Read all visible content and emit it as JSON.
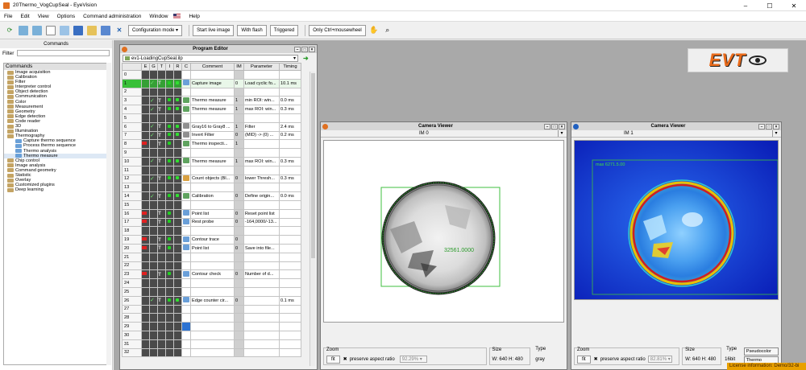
{
  "window": {
    "title": "20Thermo_VogCupSeal - EyeVision"
  },
  "menu": [
    "File",
    "Edit",
    "View",
    "Options",
    "Command administration",
    "Window",
    "Help"
  ],
  "toolbar": {
    "config_mode": "Configuration mode",
    "start_live": "Start live image",
    "with_flash": "With flash",
    "triggered": "Triggered",
    "only_ctrl": "Only Ctrl+mousewheel"
  },
  "commands_panel": {
    "header": "Commands",
    "filter_label": "Filter",
    "filter_value": "",
    "root": "Commands",
    "items": [
      {
        "label": "Image acquisition",
        "sub": false
      },
      {
        "label": "Calibration",
        "sub": false
      },
      {
        "label": "Filter",
        "sub": false
      },
      {
        "label": "Interpreter control",
        "sub": false
      },
      {
        "label": "Object detection",
        "sub": false
      },
      {
        "label": "Communication",
        "sub": false
      },
      {
        "label": "Color",
        "sub": false
      },
      {
        "label": "Measurement",
        "sub": false
      },
      {
        "label": "Geometry",
        "sub": false
      },
      {
        "label": "Edge detection",
        "sub": false
      },
      {
        "label": "Code reader",
        "sub": false
      },
      {
        "label": "3D",
        "sub": false
      },
      {
        "label": "Illumination",
        "sub": false
      },
      {
        "label": "Thermography",
        "sub": false
      },
      {
        "label": "Capture thermo sequence",
        "sub": true
      },
      {
        "label": "Process thermo sequence",
        "sub": true
      },
      {
        "label": "Thermo analysis",
        "sub": true
      },
      {
        "label": "Thermo measure",
        "sub": true
      },
      {
        "label": "Chip control",
        "sub": false
      },
      {
        "label": "Image analysis",
        "sub": false
      },
      {
        "label": "Command geometry",
        "sub": false
      },
      {
        "label": "Statistic",
        "sub": false
      },
      {
        "label": "Overlay",
        "sub": false
      },
      {
        "label": "Customized plugins",
        "sub": false
      },
      {
        "label": "Deep learning",
        "sub": false
      }
    ]
  },
  "program_editor": {
    "title": "Program Editor",
    "file": "ev1-LoadingCupSeal.ilp",
    "columns": [
      "E",
      "G",
      "T",
      "I",
      "R",
      "C",
      "Comment",
      "IM",
      "Parameter",
      "Timing"
    ],
    "rows": [
      {
        "n": "0",
        "cmd": "",
        "im": "",
        "param": "",
        "timing": "",
        "chk": false,
        "t": false,
        "x": false,
        "icon": "",
        "dots": 0
      },
      {
        "n": "1",
        "cmd": "Capture image",
        "im": "0",
        "param": "Load cyclic fo...",
        "timing": "10.1 ms",
        "chk": true,
        "t": true,
        "x": false,
        "icon": "#6a9fd8",
        "dots": 2,
        "active": true
      },
      {
        "n": "2",
        "cmd": "",
        "im": "",
        "param": "",
        "timing": "",
        "chk": false,
        "t": false,
        "x": false,
        "icon": "",
        "dots": 0
      },
      {
        "n": "3",
        "cmd": "Thermo measure",
        "im": "1",
        "param": "min ROI: win...",
        "timing": "0.0 ms",
        "chk": true,
        "t": true,
        "x": false,
        "icon": "#5fa35f",
        "dots": 2
      },
      {
        "n": "4",
        "cmd": "Thermo measure",
        "im": "1",
        "param": "max ROI: win...",
        "timing": "0.3 ms",
        "chk": true,
        "t": true,
        "x": false,
        "icon": "#5fa35f",
        "dots": 2
      },
      {
        "n": "5",
        "cmd": "",
        "im": "",
        "param": "",
        "timing": "",
        "chk": false,
        "t": false,
        "x": false,
        "icon": "",
        "dots": 0
      },
      {
        "n": "6",
        "cmd": "Gray16 to Gray8 ...",
        "im": "1",
        "param": "Filter",
        "timing": "2.4 ms",
        "chk": true,
        "t": true,
        "x": false,
        "icon": "#8f8f8f",
        "dots": 2
      },
      {
        "n": "7",
        "cmd": "Invert Filter",
        "im": "0",
        "param": "(MID) -> (0) ...",
        "timing": "0.2 ms",
        "chk": true,
        "t": true,
        "x": false,
        "icon": "#8f8f8f",
        "dots": 2
      },
      {
        "n": "8",
        "cmd": "Thermo inspecti...",
        "im": "1",
        "param": "",
        "timing": "",
        "chk": false,
        "t": true,
        "x": true,
        "icon": "#5fa35f",
        "dots": 1
      },
      {
        "n": "9",
        "cmd": "",
        "im": "",
        "param": "",
        "timing": "",
        "chk": false,
        "t": false,
        "x": false,
        "icon": "",
        "dots": 0
      },
      {
        "n": "10",
        "cmd": "Thermo measure",
        "im": "1",
        "param": "max ROI: win...",
        "timing": "0.3 ms",
        "chk": true,
        "t": true,
        "x": false,
        "icon": "#5fa35f",
        "dots": 2
      },
      {
        "n": "11",
        "cmd": "",
        "im": "",
        "param": "",
        "timing": "",
        "chk": false,
        "t": false,
        "x": false,
        "icon": "",
        "dots": 0
      },
      {
        "n": "12",
        "cmd": "Count objects (Bl...",
        "im": "0",
        "param": "lower Thresh...",
        "timing": "0.3 ms",
        "chk": true,
        "t": true,
        "x": false,
        "icon": "#d8a040",
        "dots": 2
      },
      {
        "n": "13",
        "cmd": "",
        "im": "",
        "param": "",
        "timing": "",
        "chk": false,
        "t": false,
        "x": false,
        "icon": "",
        "dots": 0
      },
      {
        "n": "14",
        "cmd": "Calibration",
        "im": "0",
        "param": "Define origin...",
        "timing": "0.0 ms",
        "chk": true,
        "t": true,
        "x": false,
        "icon": "#5fa35f",
        "dots": 2
      },
      {
        "n": "15",
        "cmd": "",
        "im": "",
        "param": "",
        "timing": "",
        "chk": false,
        "t": false,
        "x": false,
        "icon": "",
        "dots": 0
      },
      {
        "n": "16",
        "cmd": "Point list",
        "im": "0",
        "param": "Reset point list",
        "timing": "",
        "chk": false,
        "t": true,
        "x": true,
        "icon": "#6a9fd8",
        "dots": 1
      },
      {
        "n": "17",
        "cmd": "Rest probe",
        "im": "0",
        "param": "-164,0000/-13...",
        "timing": "",
        "chk": false,
        "t": true,
        "x": true,
        "icon": "#6a9fd8",
        "dots": 1
      },
      {
        "n": "18",
        "cmd": "",
        "im": "",
        "param": "",
        "timing": "",
        "chk": false,
        "t": false,
        "x": false,
        "icon": "",
        "dots": 0
      },
      {
        "n": "19",
        "cmd": "Contour trace",
        "im": "0",
        "param": "",
        "timing": "",
        "chk": false,
        "t": true,
        "x": true,
        "icon": "#6a9fd8",
        "dots": 1
      },
      {
        "n": "20",
        "cmd": "Point list",
        "im": "0",
        "param": "Save into file...",
        "timing": "",
        "chk": false,
        "t": true,
        "x": true,
        "icon": "#6a9fd8",
        "dots": 1
      },
      {
        "n": "21",
        "cmd": "",
        "im": "",
        "param": "",
        "timing": "",
        "chk": false,
        "t": false,
        "x": false,
        "icon": "",
        "dots": 0
      },
      {
        "n": "22",
        "cmd": "",
        "im": "",
        "param": "",
        "timing": "",
        "chk": false,
        "t": false,
        "x": false,
        "icon": "",
        "dots": 0
      },
      {
        "n": "23",
        "cmd": "Contour check",
        "im": "0",
        "param": "Number of d...",
        "timing": "",
        "chk": false,
        "t": true,
        "x": true,
        "icon": "#6a9fd8",
        "dots": 1
      },
      {
        "n": "24",
        "cmd": "",
        "im": "",
        "param": "",
        "timing": "",
        "chk": false,
        "t": false,
        "x": false,
        "icon": "",
        "dots": 0
      },
      {
        "n": "25",
        "cmd": "",
        "im": "",
        "param": "",
        "timing": "",
        "chk": false,
        "t": false,
        "x": false,
        "icon": "",
        "dots": 0
      },
      {
        "n": "26",
        "cmd": "Edge counter cir...",
        "im": "0",
        "param": "",
        "timing": "0.1 ms",
        "chk": true,
        "t": true,
        "x": false,
        "icon": "#6a9fd8",
        "dots": 2
      },
      {
        "n": "27",
        "cmd": "",
        "im": "",
        "param": "",
        "timing": "",
        "chk": false,
        "t": false,
        "x": false,
        "icon": "",
        "dots": 0
      },
      {
        "n": "28",
        "cmd": "",
        "im": "",
        "param": "",
        "timing": "",
        "chk": false,
        "t": false,
        "x": false,
        "icon": "",
        "dots": 0
      },
      {
        "n": "29",
        "cmd": "",
        "im": "",
        "param": "",
        "timing": "",
        "chk": false,
        "t": false,
        "x": false,
        "icon": "",
        "dots": 0,
        "blue": true
      },
      {
        "n": "30",
        "cmd": "",
        "im": "",
        "param": "",
        "timing": "",
        "chk": false,
        "t": false,
        "x": false,
        "icon": "",
        "dots": 0
      },
      {
        "n": "31",
        "cmd": "",
        "im": "",
        "param": "",
        "timing": "",
        "chk": false,
        "t": false,
        "x": false,
        "icon": "",
        "dots": 0
      },
      {
        "n": "32",
        "cmd": "",
        "im": "",
        "param": "",
        "timing": "",
        "chk": false,
        "t": false,
        "x": false,
        "icon": "",
        "dots": 0
      }
    ]
  },
  "camera0": {
    "title": "Camera Viewer",
    "tab": "IM 0",
    "overlay_value": "32561.0000",
    "zoom_label": "Zoom",
    "fit": "fit",
    "preserve": "preserve aspect ratio",
    "zoom_value": "92.29%",
    "size_label": "Size",
    "size": "W: 640   H: 480",
    "type_label": "Type",
    "type": "gray"
  },
  "camera1": {
    "title": "Camera Viewer",
    "tab": "IM 1",
    "overlay_value": "max 6271.5.00",
    "zoom_label": "Zoom",
    "fit": "fit",
    "preserve": "preserve aspect ratio",
    "zoom_value": "82.81%",
    "size_label": "Size",
    "size": "W: 640   H: 480",
    "type_label": "Type",
    "type": "16bit",
    "pseudocolor": "Pseudocolor",
    "thermo_display": "Thermo display"
  },
  "logo": "EVT",
  "license": "License information: Demo/32-bi",
  "colors": {
    "accent": "#e86a1a",
    "active_row": "#38c038",
    "license_bg": "#e8a000"
  }
}
